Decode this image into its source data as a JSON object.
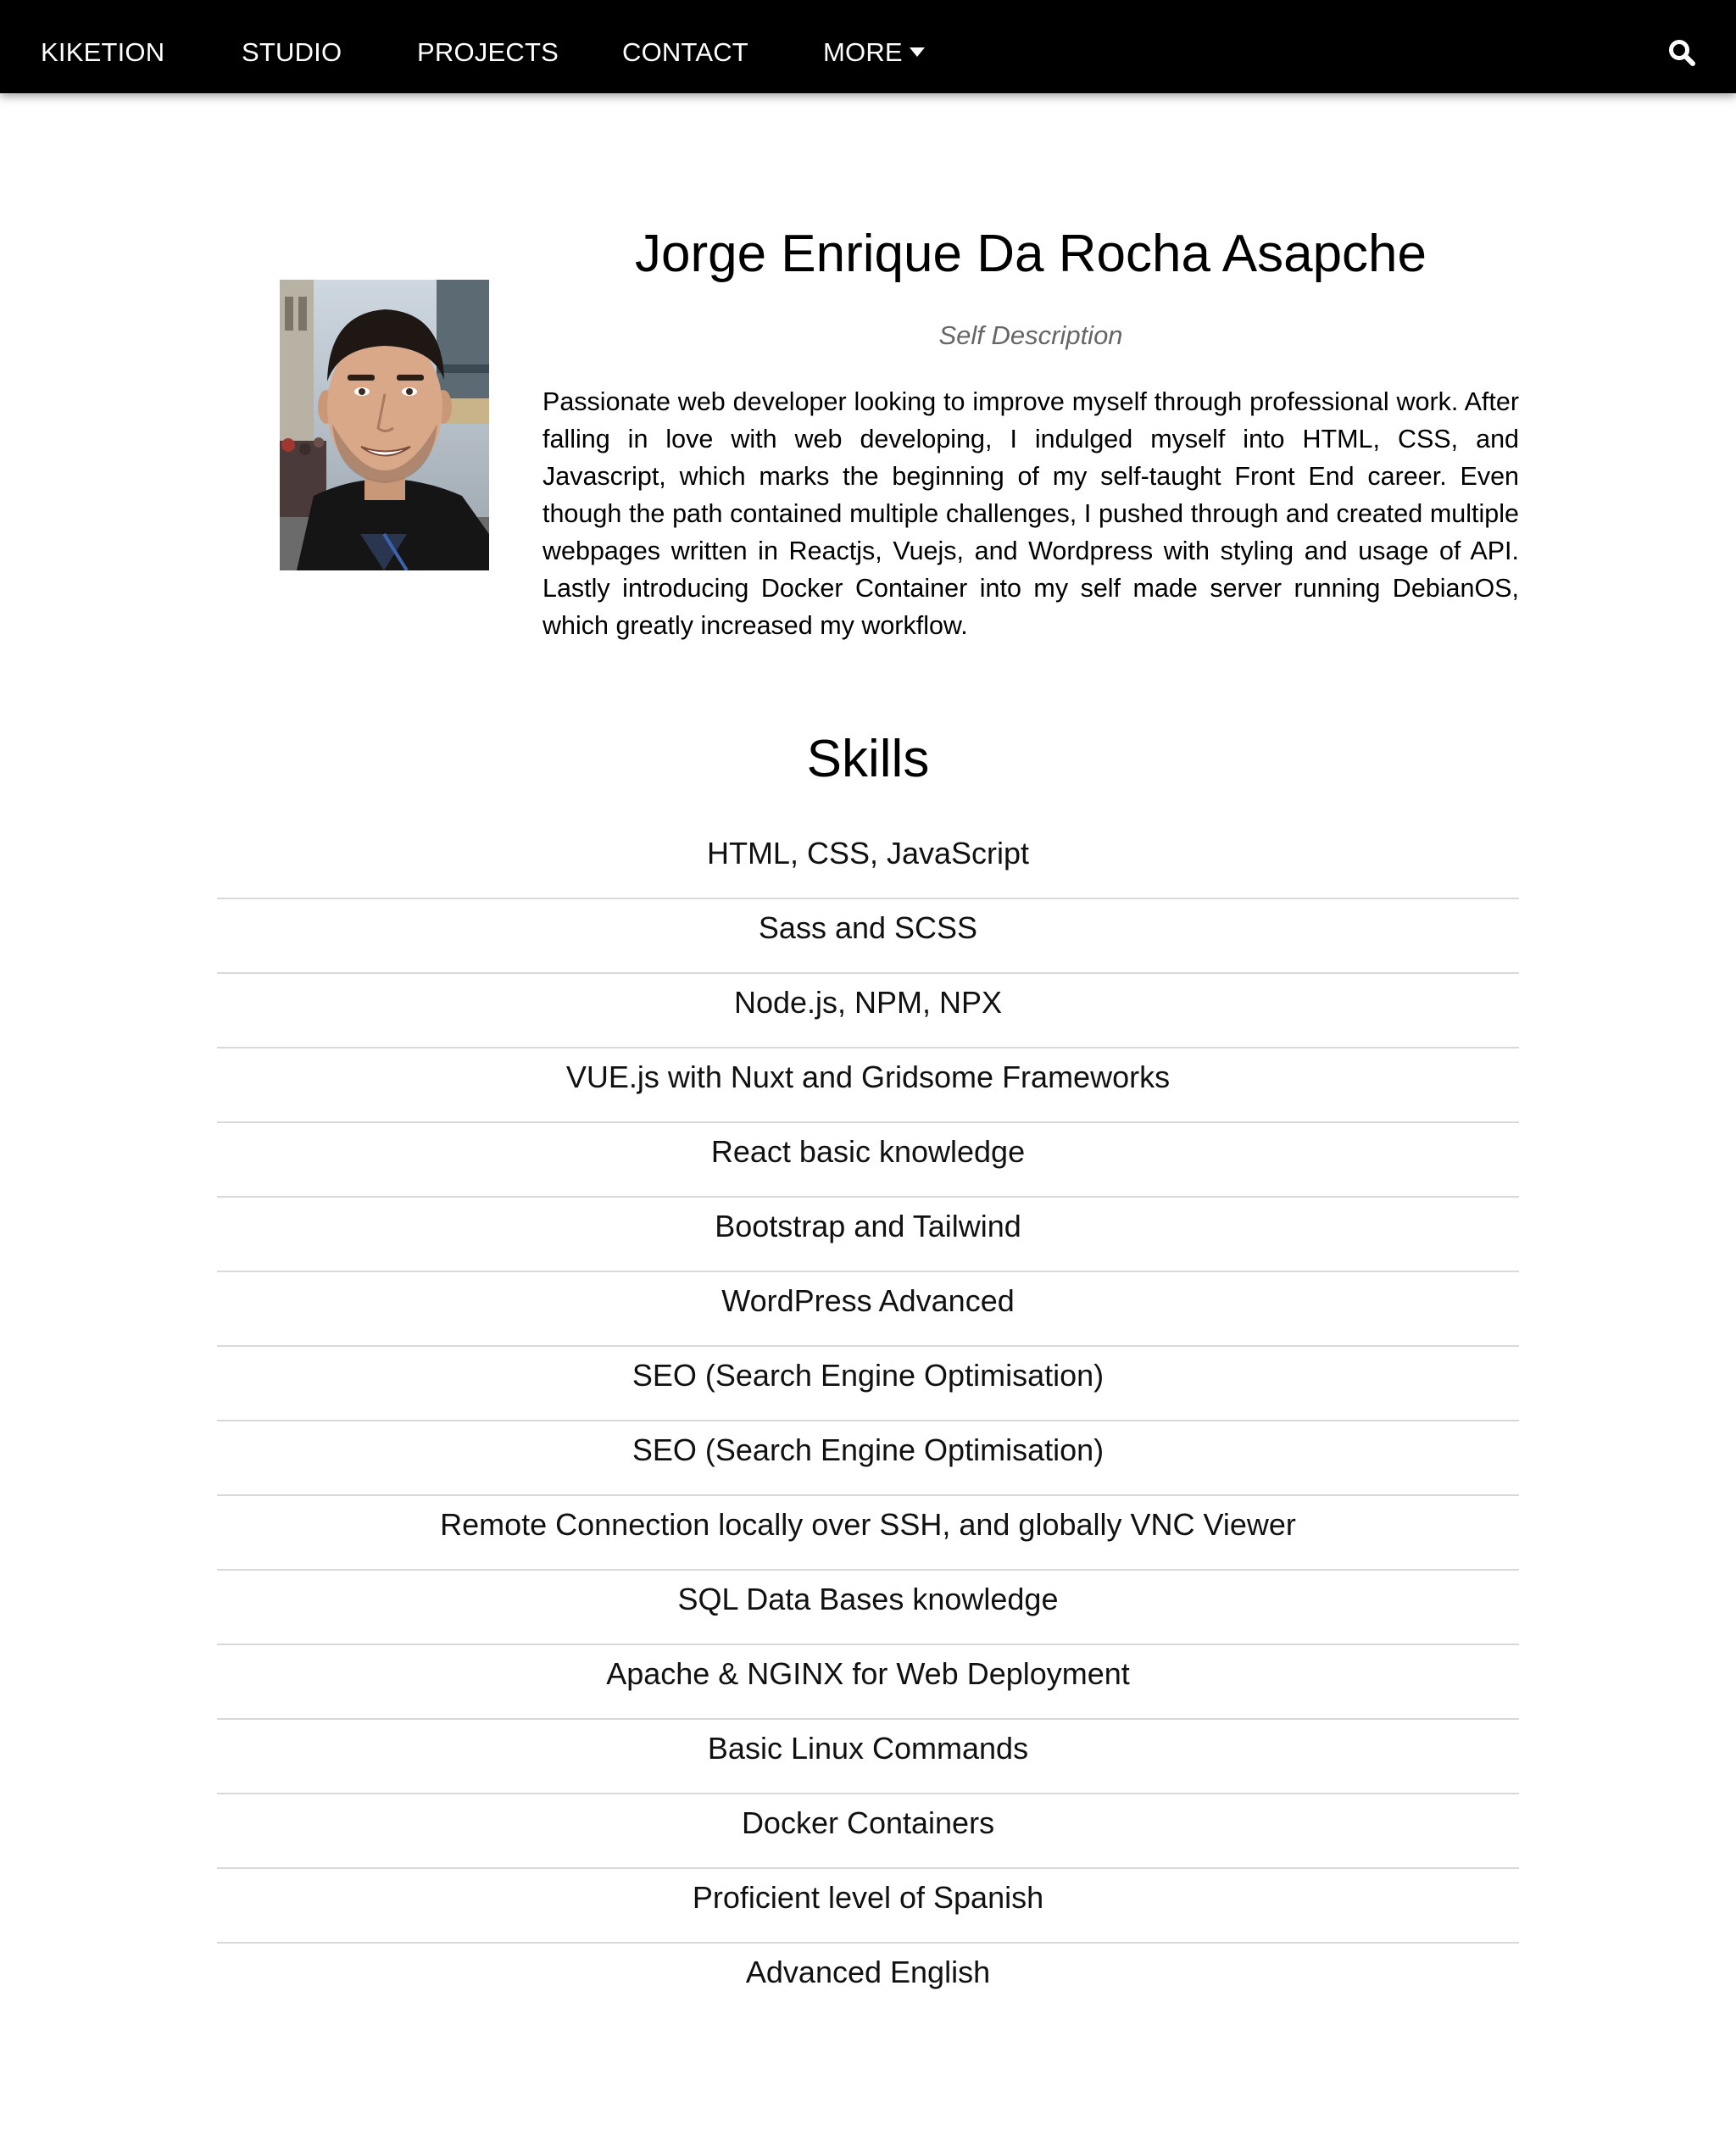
{
  "navbar": {
    "items": [
      {
        "label": "KIKETION"
      },
      {
        "label": "STUDIO"
      },
      {
        "label": "PROJECTS"
      },
      {
        "label": "CONTACT"
      },
      {
        "label": "MORE",
        "icon": "caret-down-icon"
      }
    ],
    "search_icon": "search-icon",
    "background": "#000000",
    "text_color": "#ffffff"
  },
  "profile": {
    "name": "Jorge Enrique Da Rocha Asapche",
    "subtitle": "Self Description",
    "description": "Passionate web developer looking to improve myself through professional work. After falling in love with web developing, I indulged myself into HTML, CSS, and Javascript, which marks the beginning of my self-taught Front End career. Even though the path contained multiple challenges, I pushed through and created multiple webpages written in Reactjs, Vuejs, and Wordpress with styling and usage of API. Lastly introducing Docker Container into my self made server running DebianOS, which greatly increased my workflow."
  },
  "skills": {
    "title": "Skills",
    "items": [
      "HTML, CSS, JavaScript",
      "Sass and SCSS",
      "Node.js, NPM, NPX",
      "VUE.js with Nuxt and Gridsome Frameworks",
      "React basic knowledge",
      "Bootstrap and Tailwind",
      "WordPress Advanced",
      "SEO (Search Engine Optimisation)",
      "SEO (Search Engine Optimisation)",
      "Remote Connection locally over SSH, and globally VNC Viewer",
      "SQL Data Bases knowledge",
      "Apache & NGINX for Web Deployment",
      "Basic Linux Commands",
      "Docker Containers",
      "Proficient level of Spanish",
      "Advanced English"
    ]
  }
}
